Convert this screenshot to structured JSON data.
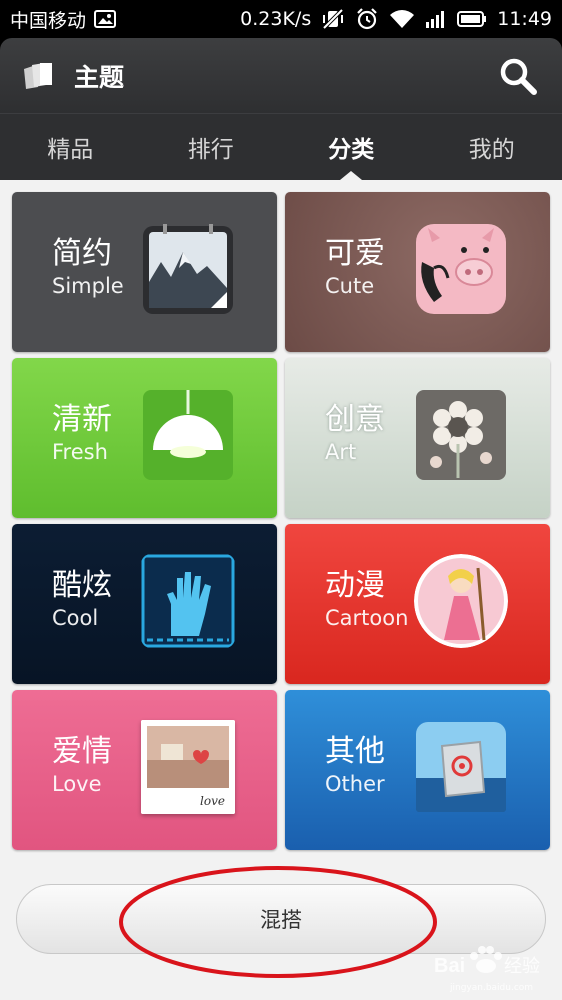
{
  "status_bar": {
    "carrier": "中国移动",
    "speed": "0.23K/s",
    "time": "11:49"
  },
  "app_bar": {
    "title": "主题",
    "icons": [
      "themes-logo-icon",
      "search-icon"
    ]
  },
  "tabs": [
    {
      "label": "精品",
      "active": false
    },
    {
      "label": "排行",
      "active": false
    },
    {
      "label": "分类",
      "active": true
    },
    {
      "label": "我的",
      "active": false
    }
  ],
  "categories": [
    {
      "zh": "简约",
      "en": "Simple",
      "color": "#4c4d50",
      "icon": "mountain-calendar-icon"
    },
    {
      "zh": "可爱",
      "en": "Cute",
      "color": "#7a5751",
      "icon": "pig-phone-icon"
    },
    {
      "zh": "清新",
      "en": "Fresh",
      "color": "#6cc83a",
      "icon": "lamp-icon"
    },
    {
      "zh": "创意",
      "en": "Art",
      "color": "#d5ddd5",
      "icon": "flower-icon"
    },
    {
      "zh": "酷炫",
      "en": "Cool",
      "color": "#0a1a2e",
      "icon": "handprint-scanner-icon"
    },
    {
      "zh": "动漫",
      "en": "Cartoon",
      "color": "#e5342c",
      "icon": "cartoon-girl-icon"
    },
    {
      "zh": "爱情",
      "en": "Love",
      "color": "#e8628b",
      "icon": "love-photo-icon",
      "thumb_text": "love"
    },
    {
      "zh": "其他",
      "en": "Other",
      "color": "#2574c4",
      "icon": "mail-can-icon"
    }
  ],
  "mix_button": {
    "label": "混搭"
  },
  "annotation": {
    "color": "#d9141b"
  },
  "watermark": {
    "text": "Bai 经验",
    "sub": "jingyan.baidu.com"
  }
}
